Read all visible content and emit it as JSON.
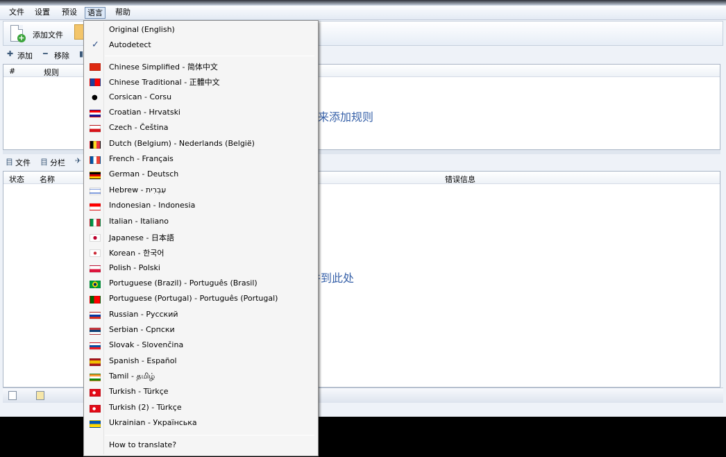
{
  "menubar": {
    "items": [
      "文件",
      "设置",
      "预设",
      "语言",
      "帮助"
    ]
  },
  "toolbar": {
    "add_file_label": "添加文件"
  },
  "rules_toolbar": {
    "add_label": "添加",
    "remove_label": "移除"
  },
  "rules_table": {
    "columns": [
      "#",
      "规则"
    ],
    "empty_hint": "来添加规则"
  },
  "files_toolbar": {
    "files_label": "文件",
    "split_label": "分栏"
  },
  "files_table": {
    "columns": [
      "状态",
      "名称",
      "错误信息"
    ],
    "empty_hint": "件到此处"
  },
  "language_menu": {
    "checked_item": "Autodetect",
    "items": [
      {
        "label": "Original (English)",
        "flag": "none"
      },
      {
        "label": "Autodetect",
        "flag": "check-icon"
      },
      {
        "label": "Chinese Simplified - 简体中文",
        "flag": "cn-flag-icon"
      },
      {
        "label": "Chinese Traditional - 正體中文",
        "flag": "tw-flag-icon"
      },
      {
        "label": "Corsican - Corsu",
        "flag": "corsica-flag-icon"
      },
      {
        "label": "Croatian - Hrvatski",
        "flag": "hr-flag-icon"
      },
      {
        "label": "Czech - Čeština",
        "flag": "cz-flag-icon"
      },
      {
        "label": "Dutch (Belgium) - Nederlands (België)",
        "flag": "be-flag-icon"
      },
      {
        "label": "French - Français",
        "flag": "fr-flag-icon"
      },
      {
        "label": "German - Deutsch",
        "flag": "de-flag-icon"
      },
      {
        "label": "Hebrew - עִבְרִית",
        "flag": "il-flag-icon"
      },
      {
        "label": "Indonesian - Indonesia",
        "flag": "id-flag-icon"
      },
      {
        "label": "Italian - Italiano",
        "flag": "it-flag-icon"
      },
      {
        "label": "Japanese - 日本語",
        "flag": "jp-flag-icon"
      },
      {
        "label": "Korean - 한국어",
        "flag": "kr-flag-icon"
      },
      {
        "label": "Polish - Polski",
        "flag": "pl-flag-icon"
      },
      {
        "label": "Portuguese (Brazil) - Português (Brasil)",
        "flag": "br-flag-icon"
      },
      {
        "label": "Portuguese (Portugal) - Português (Portugal)",
        "flag": "pt-flag-icon"
      },
      {
        "label": "Russian - Русский",
        "flag": "ru-flag-icon"
      },
      {
        "label": "Serbian - Српски",
        "flag": "rs-flag-icon"
      },
      {
        "label": "Slovak - Slovenčina",
        "flag": "sk-flag-icon"
      },
      {
        "label": "Spanish - Español",
        "flag": "es-flag-icon"
      },
      {
        "label": "Tamil - தமிழ்",
        "flag": "in-flag-icon"
      },
      {
        "label": "Turkish - Türkçe",
        "flag": "tr-flag-icon"
      },
      {
        "label": "Turkish (2) - Türkçe",
        "flag": "tr-flag-icon"
      },
      {
        "label": "Ukrainian - Українська",
        "flag": "ua-flag-icon"
      }
    ],
    "footer_item": "How to translate?"
  },
  "colors": {
    "hint_text": "#3660a8",
    "menu_highlight": "#dce8f7",
    "frame_background": "#000000"
  }
}
